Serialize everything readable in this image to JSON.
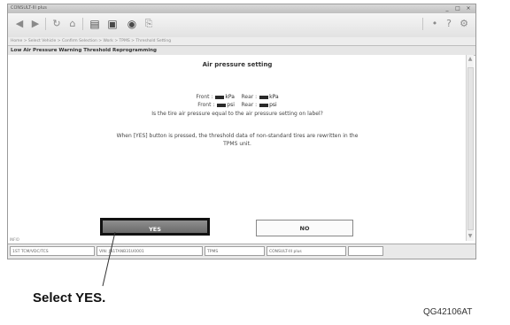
{
  "window": {
    "title": "CONSULT-III plus",
    "controls": [
      "_",
      "□",
      "×"
    ]
  },
  "toolbar": {
    "back": "◀",
    "forward": "▶",
    "refresh": "↻",
    "home": "⌂",
    "print": "▤",
    "capture": "▣",
    "record": "◉",
    "save": "⎘",
    "help": "?",
    "settings": "⚙",
    "dot": "•"
  },
  "breadcrumb": "Home > Select Vehicle > Confirm Selection > Work > TPMS > Threshold Setting",
  "section_title": "Low Air Pressure Warning Threshold Reprogramming",
  "dialog": {
    "heading": "Air pressure setting",
    "front_label": "Front :",
    "front_unit1": "kPa",
    "rear_label": "Rear :",
    "rear_unit1": "kPa",
    "front_unit2": "psi",
    "rear_unit2": "psi",
    "question": "Is the tire air pressure equal to the air pressure setting on label?",
    "note_line1": "When [YES] button is pressed, the threshold data of non-standard tires are rewritten in the",
    "note_line2": "TPMS unit.",
    "yes_label": "YES",
    "no_label": "NO"
  },
  "status": {
    "left_label": "INFIO",
    "cells": [
      "1ST TCM/VDC/TCS",
      "VIN: JN1TANB31U0001",
      "TPMS",
      "CONSULT-III plus"
    ]
  },
  "annotation": {
    "callout": "Select YES.",
    "figure_code": "QG42106AT"
  }
}
